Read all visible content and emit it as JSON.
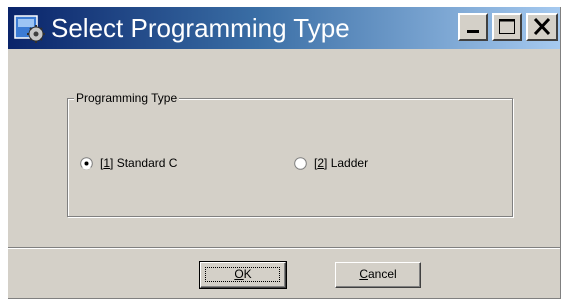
{
  "window": {
    "title": "Select Programming Type",
    "icons": [
      "app-icon",
      "minimize-icon",
      "maximize-icon",
      "close-icon"
    ]
  },
  "group": {
    "label": "Programming Type"
  },
  "options": [
    {
      "mnemonic": "1",
      "prefix_open": "[",
      "prefix_close": "]",
      "text": " Standard C",
      "selected": true
    },
    {
      "mnemonic": "2",
      "prefix_open": "[",
      "prefix_close": "]",
      "text": " Ladder",
      "selected": false
    }
  ],
  "buttons": {
    "ok": {
      "mnemonic": "O",
      "rest": "K"
    },
    "cancel": {
      "mnemonic": "C",
      "rest": "ancel"
    }
  },
  "colors": {
    "face": "#d4d0c8",
    "title_start": "#0a246a",
    "title_end": "#a6caf0"
  }
}
